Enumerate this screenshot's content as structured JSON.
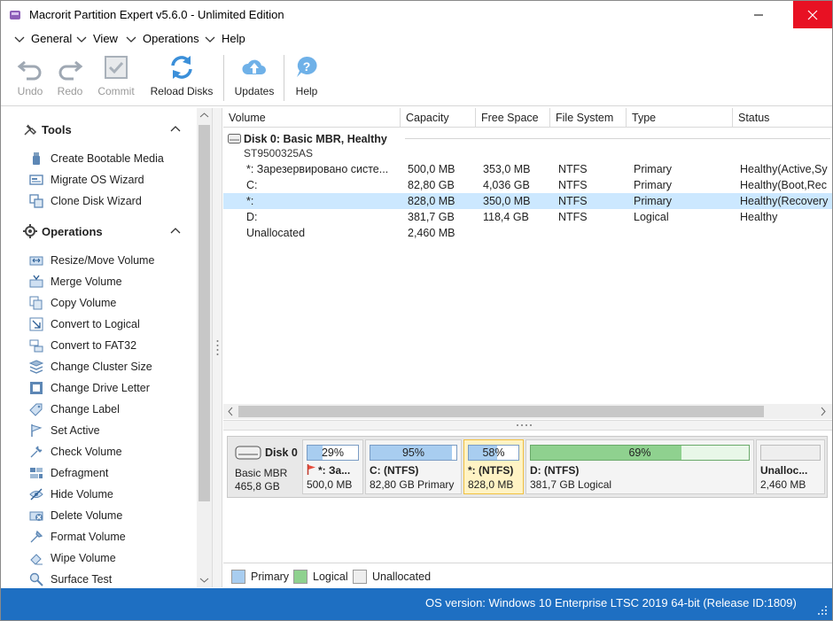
{
  "window": {
    "title": "Macrorit Partition Expert v5.6.0 - Unlimited Edition"
  },
  "menu": [
    {
      "label": "General"
    },
    {
      "label": "View"
    },
    {
      "label": "Operations"
    },
    {
      "label": "Help"
    }
  ],
  "toolbar": {
    "undo": "Undo",
    "redo": "Redo",
    "commit": "Commit",
    "reload": "Reload Disks",
    "updates": "Updates",
    "help": "Help"
  },
  "sidebar": {
    "tools_title": "Tools",
    "tools": [
      {
        "label": "Create Bootable Media",
        "icon": "usb-icon"
      },
      {
        "label": "Migrate OS Wizard",
        "icon": "migrate-icon"
      },
      {
        "label": "Clone Disk Wizard",
        "icon": "clone-icon"
      }
    ],
    "operations_title": "Operations",
    "operations": [
      {
        "label": "Resize/Move Volume",
        "icon": "resize-icon"
      },
      {
        "label": "Merge Volume",
        "icon": "merge-icon"
      },
      {
        "label": "Copy Volume",
        "icon": "copy-icon"
      },
      {
        "label": "Convert to Logical",
        "icon": "convert-icon"
      },
      {
        "label": "Convert to FAT32",
        "icon": "fat32-icon"
      },
      {
        "label": "Change Cluster Size",
        "icon": "cluster-icon"
      },
      {
        "label": "Change Drive Letter",
        "icon": "drive-letter-icon"
      },
      {
        "label": "Change Label",
        "icon": "label-icon"
      },
      {
        "label": "Set Active",
        "icon": "flag-icon"
      },
      {
        "label": "Check Volume",
        "icon": "check-icon"
      },
      {
        "label": "Defragment",
        "icon": "defrag-icon"
      },
      {
        "label": "Hide Volume",
        "icon": "hide-icon"
      },
      {
        "label": "Delete Volume",
        "icon": "delete-icon"
      },
      {
        "label": "Format Volume",
        "icon": "format-icon"
      },
      {
        "label": "Wipe Volume",
        "icon": "wipe-icon"
      },
      {
        "label": "Surface Test",
        "icon": "surface-icon"
      }
    ]
  },
  "table": {
    "columns": [
      "Volume",
      "Capacity",
      "Free Space",
      "File System",
      "Type",
      "Status"
    ],
    "disk": {
      "title": "Disk 0: Basic MBR, Healthy",
      "model": "ST9500325AS"
    },
    "rows": [
      {
        "volume": "*: Зарезервировано систе...",
        "capacity": "500,0 MB",
        "free": "353,0 MB",
        "fs": "NTFS",
        "type": "Primary",
        "status": "Healthy(Active,Sy"
      },
      {
        "volume": "C:",
        "capacity": "82,80 GB",
        "free": "4,036 GB",
        "fs": "NTFS",
        "type": "Primary",
        "status": "Healthy(Boot,Rec"
      },
      {
        "volume": "*:",
        "capacity": "828,0 MB",
        "free": "350,0 MB",
        "fs": "NTFS",
        "type": "Primary",
        "status": "Healthy(Recovery"
      },
      {
        "volume": "D:",
        "capacity": "381,7 GB",
        "free": "118,4 GB",
        "fs": "NTFS",
        "type": "Logical",
        "status": "Healthy"
      },
      {
        "volume": "Unallocated",
        "capacity": "2,460 MB",
        "free": "",
        "fs": "",
        "type": "",
        "status": ""
      }
    ],
    "selected_row": 2
  },
  "diskmap": {
    "disk": {
      "name": "Disk 0",
      "type": "Basic MBR",
      "size": "465,8 GB"
    },
    "partitions": [
      {
        "pct_label": "29%",
        "used": 0.29,
        "name": "*: За...",
        "info": "500,0 MB",
        "kind": "primary"
      },
      {
        "pct_label": "95%",
        "used": 0.95,
        "name": "C: (NTFS)",
        "info": "82,80 GB Primary",
        "kind": "primary"
      },
      {
        "pct_label": "58%",
        "used": 0.58,
        "name": "*: (NTFS)",
        "info": "828,0 MB",
        "kind": "primary"
      },
      {
        "pct_label": "69%",
        "used": 0.69,
        "name": "D: (NTFS)",
        "info": "381,7 GB Logical",
        "kind": "logical"
      },
      {
        "pct_label": "",
        "used": 0,
        "name": "Unalloc...",
        "info": "2,460 MB",
        "kind": "unallocated"
      }
    ]
  },
  "legend": {
    "primary": "Primary",
    "logical": "Logical",
    "unallocated": "Unallocated"
  },
  "colors": {
    "primary": "#a8cdf0",
    "logical": "#8fd18f",
    "accent": "#1e6fc2",
    "selected": "#cce8ff",
    "close": "#e81123"
  },
  "status": {
    "text": "OS version: Windows 10 Enterprise LTSC 2019  64-bit  (Release ID:1809)"
  }
}
